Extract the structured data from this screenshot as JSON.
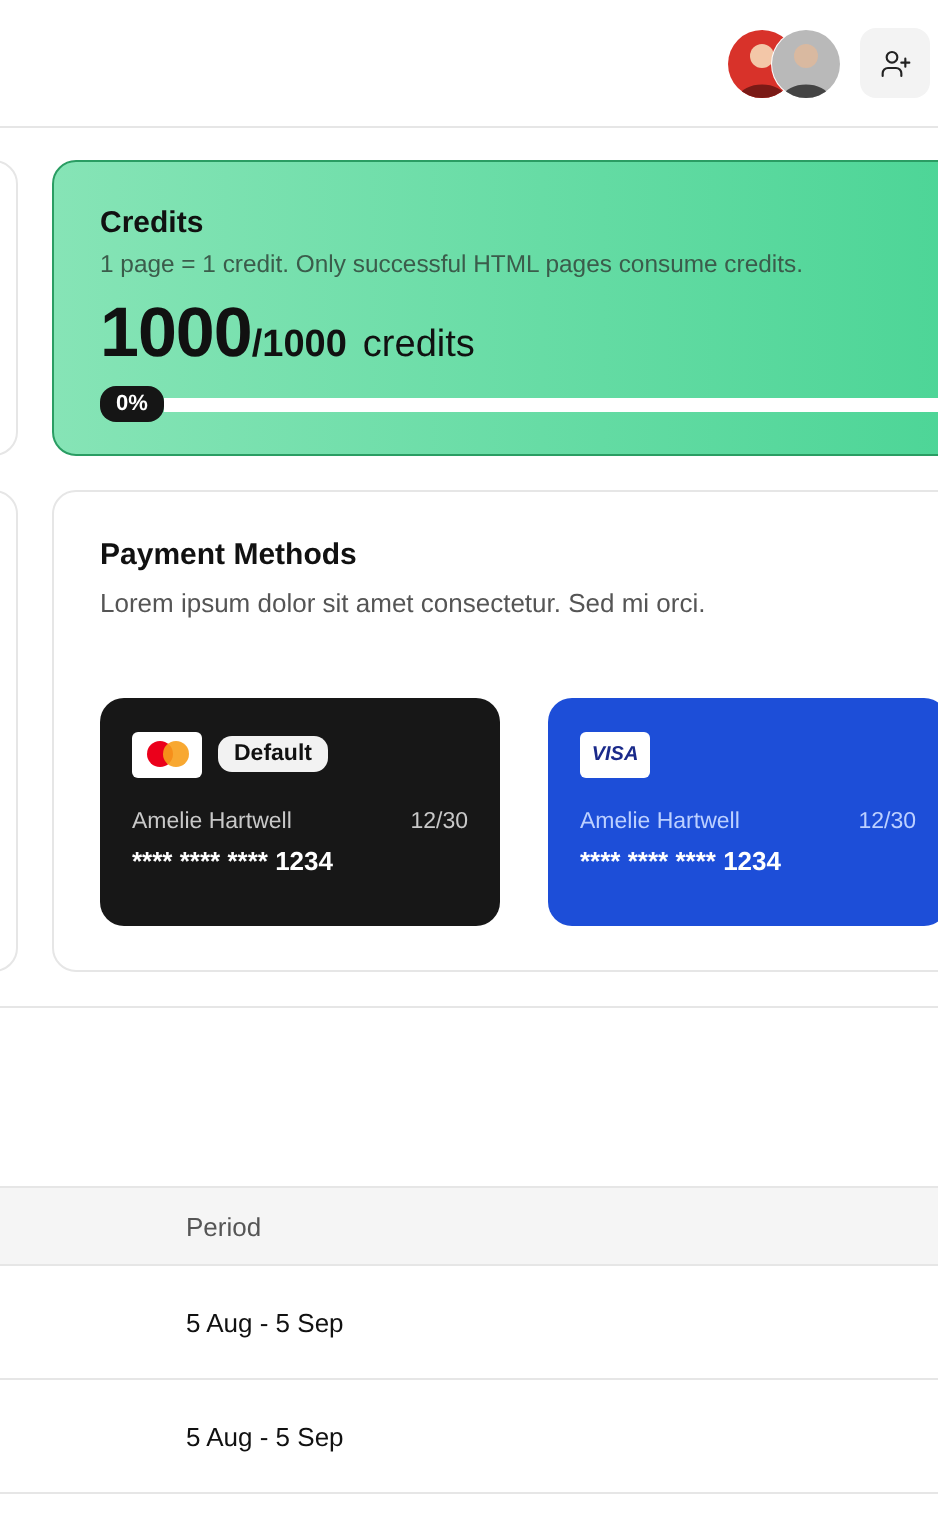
{
  "credits": {
    "title": "Credits",
    "description": "1 page = 1 credit. Only successful HTML pages consume credits.",
    "used": "1000",
    "total": "/1000",
    "unit": "credits",
    "progress_label": "0%"
  },
  "payment_methods": {
    "title": "Payment Methods",
    "description": "Lorem ipsum dolor sit amet consectetur. Sed mi orci.",
    "cards": [
      {
        "kind": "mastercard",
        "default": true,
        "default_label": "Default",
        "holder": "Amelie Hartwell",
        "expiry": "12/30",
        "number_mask": "**** **** ****",
        "last4": "1234"
      },
      {
        "kind": "visa",
        "default": false,
        "brand_label": "VISA",
        "holder": "Amelie Hartwell",
        "expiry": "12/30",
        "number_mask": "**** **** ****",
        "last4": "1234"
      }
    ]
  },
  "table": {
    "columns": [
      "Period"
    ],
    "rows": [
      {
        "period": "5 Aug - 5 Sep"
      },
      {
        "period": "5 Aug - 5 Sep"
      }
    ]
  }
}
